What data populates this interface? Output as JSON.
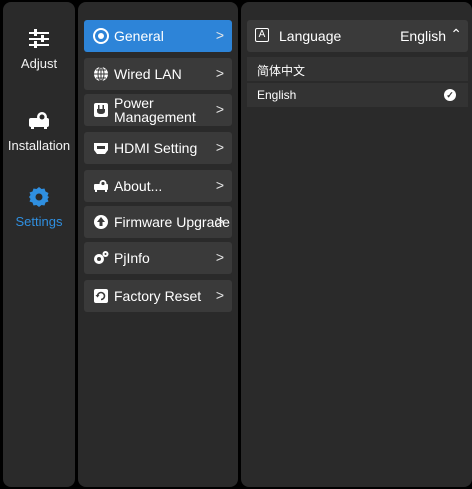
{
  "nav": {
    "items": [
      {
        "label": "Adjust",
        "icon": "sliders-icon"
      },
      {
        "label": "Installation",
        "icon": "projector-icon"
      },
      {
        "label": "Settings",
        "icon": "gear-icon",
        "active": true
      }
    ]
  },
  "menu": {
    "items": [
      {
        "label": "General",
        "icon": "radio-target-icon",
        "active": true
      },
      {
        "label": "Wired LAN",
        "icon": "globe-icon"
      },
      {
        "label": "Power Management",
        "icon": "plug-icon"
      },
      {
        "label": "HDMI Setting",
        "icon": "hdmi-icon"
      },
      {
        "label": "About...",
        "icon": "projector-icon"
      },
      {
        "label": "Firmware Upgrade",
        "icon": "upgrade-icon"
      },
      {
        "label": "PjInfo",
        "icon": "gears-icon"
      },
      {
        "label": "Factory Reset",
        "icon": "reset-icon"
      }
    ],
    "chevron": ">"
  },
  "detail": {
    "language": {
      "title": "Language",
      "value": "English",
      "options": [
        "简体中文",
        "English"
      ],
      "selected": "English"
    }
  },
  "colors": {
    "accent": "#2d84d8",
    "panel": "#2a2a2a",
    "item": "#3a3a3a"
  }
}
